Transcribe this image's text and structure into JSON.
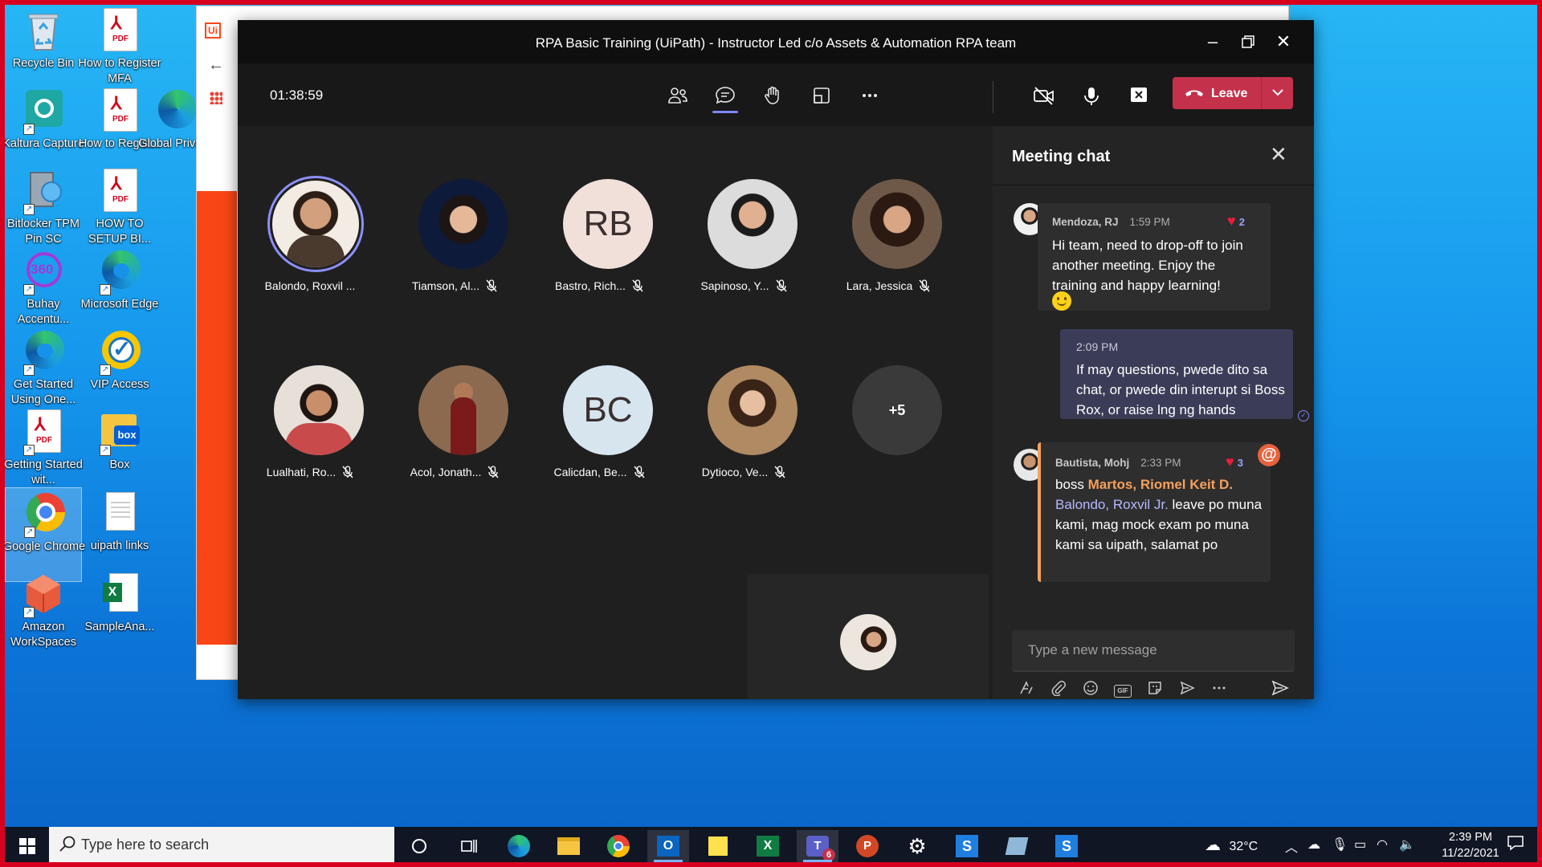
{
  "desktop": {
    "icons": [
      {
        "label": "Recycle Bin"
      },
      {
        "label": "How to Register MFA"
      },
      {
        "label": "Kaltura Capture"
      },
      {
        "label": "How to Regist..."
      },
      {
        "label": "Global Privacy"
      },
      {
        "label": "Bitlocker TPM Pin SC"
      },
      {
        "label": "HOW TO SETUP BI..."
      },
      {
        "label": "Buhay Accentu..."
      },
      {
        "label": "Microsoft Edge"
      },
      {
        "label": "Get Started Using One..."
      },
      {
        "label": "VIP Access"
      },
      {
        "label": "Getting Started wit..."
      },
      {
        "label": "Box"
      },
      {
        "label": "Google Chrome"
      },
      {
        "label": "uipath links"
      },
      {
        "label": "Amazon WorkSpaces"
      },
      {
        "label": "SampleAna..."
      }
    ],
    "pdf_tag": "PDF",
    "box_tag": "box",
    "bgwin_tag": "Ui"
  },
  "meeting": {
    "title": "RPA Basic Training (UiPath) - Instructor Led c/o Assets & Automation RPA team",
    "timer": "01:38:59",
    "leave_label": "Leave",
    "participants": [
      {
        "name": "Balondo, Roxvil ...",
        "muted": false
      },
      {
        "name": "Tiamson, Al...",
        "muted": true
      },
      {
        "name": "Bastro, Rich...",
        "muted": true,
        "initials": "RB"
      },
      {
        "name": "Sapinoso, Y...",
        "muted": true
      },
      {
        "name": "Lara, Jessica",
        "muted": true
      },
      {
        "name": "Lualhati, Ro...",
        "muted": true
      },
      {
        "name": "Acol, Jonath...",
        "muted": true
      },
      {
        "name": "Calicdan, Be...",
        "muted": true,
        "initials": "BC"
      },
      {
        "name": "Dytioco, Ve...",
        "muted": true
      }
    ],
    "overflow": "+5"
  },
  "chat": {
    "title": "Meeting chat",
    "messages": [
      {
        "author": "Mendoza, RJ",
        "time": "1:59 PM",
        "reactions": "2",
        "text": "Hi team, need to drop-off to join another meeting. Enjoy the training and happy learning!"
      },
      {
        "time": "2:09 PM",
        "text": "If may questions, pwede dito sa chat, or pwede din interupt si Boss Rox, or raise lng ng hands"
      },
      {
        "author": "Bautista, Mohj",
        "time": "2:33 PM",
        "reactions": "3",
        "pre": "boss ",
        "mention1": "Martos, Riomel Keit D.",
        "mention2": " Balondo, Roxvil Jr.",
        "post": " leave po muna kami, mag mock exam po muna kami sa uipath, salamat po"
      }
    ],
    "input_placeholder": "Type a new message",
    "gif_label": "GIF"
  },
  "taskbar": {
    "search_placeholder": "Type here to search",
    "weather": "32°C",
    "time": "2:39 PM",
    "date": "11/22/2021",
    "teams_badge": "6"
  }
}
